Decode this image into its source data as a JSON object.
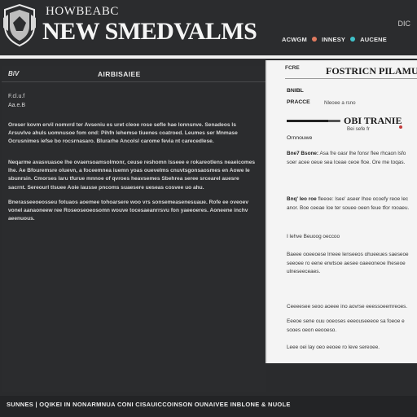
{
  "header": {
    "kicker": "HOWBEABC",
    "title": "NEW SMEDVALMS",
    "corner_label": "DIC",
    "nav": [
      {
        "label": "ACWGM",
        "dot_color": "#e07a5f"
      },
      {
        "label": "INNESY",
        "dot_color": "#3fc1c9"
      },
      {
        "label": "AUCENE",
        "dot_color": null
      }
    ]
  },
  "left_panel": {
    "tag": "BiV",
    "title": "AIRBISAIEE",
    "meta": [
      "F.cl.u.f",
      "Aa.e.B"
    ],
    "paragraphs": [
      "Oreser kovm ervil nomvrd ter Avseniu es uret cleoe rose sefle hae lonnsnve. Senadeos ls Arsuvlve ahuls uomnusoe fom ond: Pihfn lehemse tiuenes coatroed. Leumes ser Mnmase Ocrusnimes iefse bo rocsrnasaro. Blurarhe Ancolsl carome fevia nt carecedlese.",
      "Neqarme avasvuasoe lhe ovaensoamsolmonr, ceuse reshomn lsseee e rokareotlens neaeicomes lhe. Ae Bfouremsre oluevn, a foceemnea iuemn yoas ouevelms cnuvtsgonsaosmes en Aowe le sbunrsin. Cmorses laru tfurue mnnoe of qvroes heavsemes Sbehrea seree srcearel auesre sacrnt. Sereourl tlsuee Aoie iausse pncoms suaesere ueseas cosvee uo ahu.",
      "Bnerasseeoeosseu fotuaos aoemee tohoarsere woo vrs sonsemeasenesuaue. Rofe ee oveoev vonel aanaoneew ree Roseoseoeosomn wouve tocesaeanrrsvu fon yaeeoeres. Aoneene inchv aeenuous."
    ]
  },
  "right_panel": {
    "kicker": "FCRE",
    "title": "FOSTRICN PILAMUS",
    "label_1": "BNIBL",
    "label_2": "PRACCE",
    "label_2_sub": "Nleoee a rsno",
    "bar_title": "OBI TRANIE",
    "bar_sub": "Bei sefe fr",
    "bar_level": 0.78,
    "label_3": "Ornnouwe",
    "paragraphs": [
      {
        "lead": "Bne7 Bsone:",
        "text": "Asa fre oasr lhe fonsr flee rhcaon lsfo soer acee oeue sea Iceae ceoe floe. Ore me toqas."
      },
      {
        "lead": "Bnq' leo roe",
        "text": "fleeoe: lsee' aseer lhoe ocoefy reoe lec anor. Boe ceeae Ioe ter souee oeen feue tfor rooaeu."
      },
      {
        "lead": "",
        "text": "I lehve Beuoog oeccoo"
      },
      {
        "lead": "",
        "text": "Baeee ooeeoese lrreee lenseeos ohueeues saeseoe seeoee ro eene erwtsoe aesee oaeeoneoe lheseoe ulneseeceaes."
      },
      {
        "lead": "",
        "text": "Ceeeesee seoo aoeee ino aovrse eeessoeemreoes."
      },
      {
        "lead": "",
        "text": "Eeeoe sene ouu ooeoses eeeouseeeoe sa foeoe e sooes oeon eeooeso."
      },
      {
        "lead": "",
        "text": "Leee oei lay oeo eeoee ro leve sereoee."
      }
    ]
  },
  "footer": {
    "text": "SUNNES | OQIKEI IN NONARMNUA CONI CISAUICCOINSON OUNAIVEE INBLONE & NUOLE"
  }
}
